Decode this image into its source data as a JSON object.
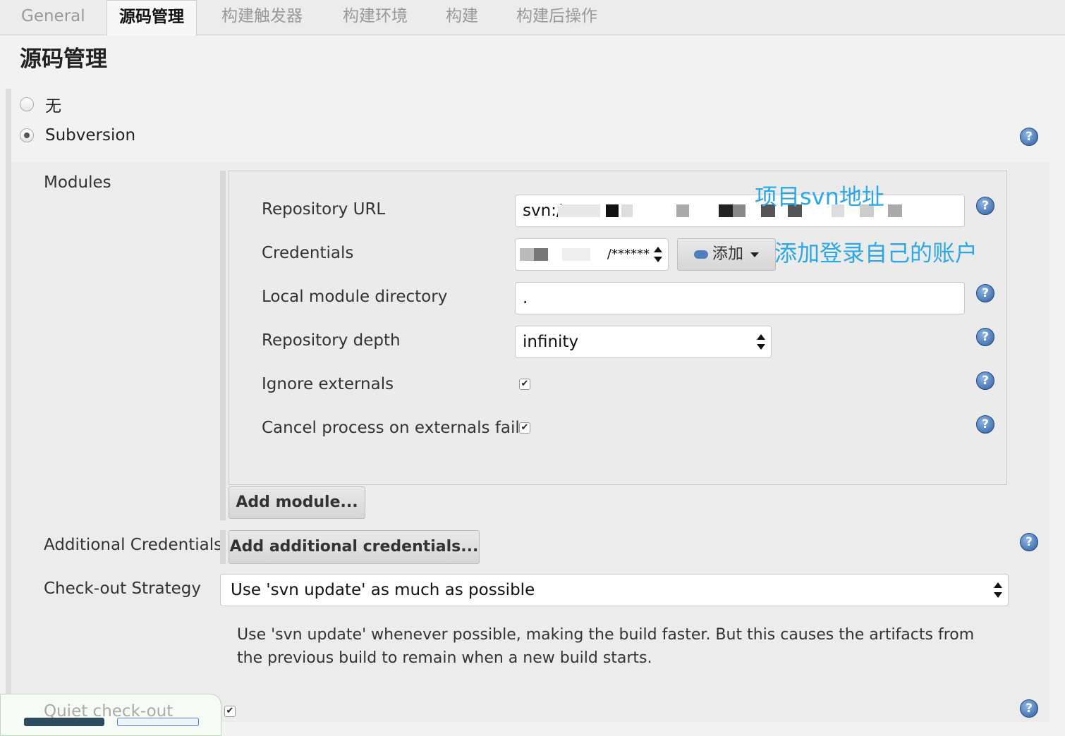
{
  "tabs": [
    {
      "label": "General"
    },
    {
      "label": "源码管理"
    },
    {
      "label": "构建触发器"
    },
    {
      "label": "构建环境"
    },
    {
      "label": "构建"
    },
    {
      "label": "构建后操作"
    }
  ],
  "section_title": "源码管理",
  "scm_options": [
    {
      "label": "无",
      "selected": false
    },
    {
      "label": "Subversion",
      "selected": true
    }
  ],
  "modules": {
    "label": "Modules",
    "repository_url": {
      "label": "Repository URL",
      "value_prefix": "svn:/"
    },
    "credentials": {
      "label": "Credentials",
      "value_suffix": "/******",
      "add_button": "添加"
    },
    "local_module_directory": {
      "label": "Local module directory",
      "value": "."
    },
    "repository_depth": {
      "label": "Repository depth",
      "value": "infinity"
    },
    "ignore_externals": {
      "label": "Ignore externals",
      "checked": true
    },
    "cancel_process": {
      "label": "Cancel process on externals fail",
      "checked": true
    },
    "add_module_button": "Add module..."
  },
  "additional_credentials": {
    "label": "Additional Credentials",
    "button": "Add additional credentials..."
  },
  "checkout_strategy": {
    "label": "Check-out Strategy",
    "value": "Use 'svn update' as much as possible",
    "description": "Use 'svn update' whenever possible, making the build faster. But this causes the artifacts from the previous build to remain when a new build starts."
  },
  "quiet_checkout": {
    "label": "Quiet check-out",
    "checked": true
  },
  "annotations": {
    "svn_address": "项目svn地址",
    "add_account": "添加登录自己的账户"
  },
  "help_icon_glyph": "?",
  "checkbox_glyph": "✔",
  "colors": {
    "annotation": "#2aa8e8",
    "help_icon": "#2b5c9e"
  }
}
